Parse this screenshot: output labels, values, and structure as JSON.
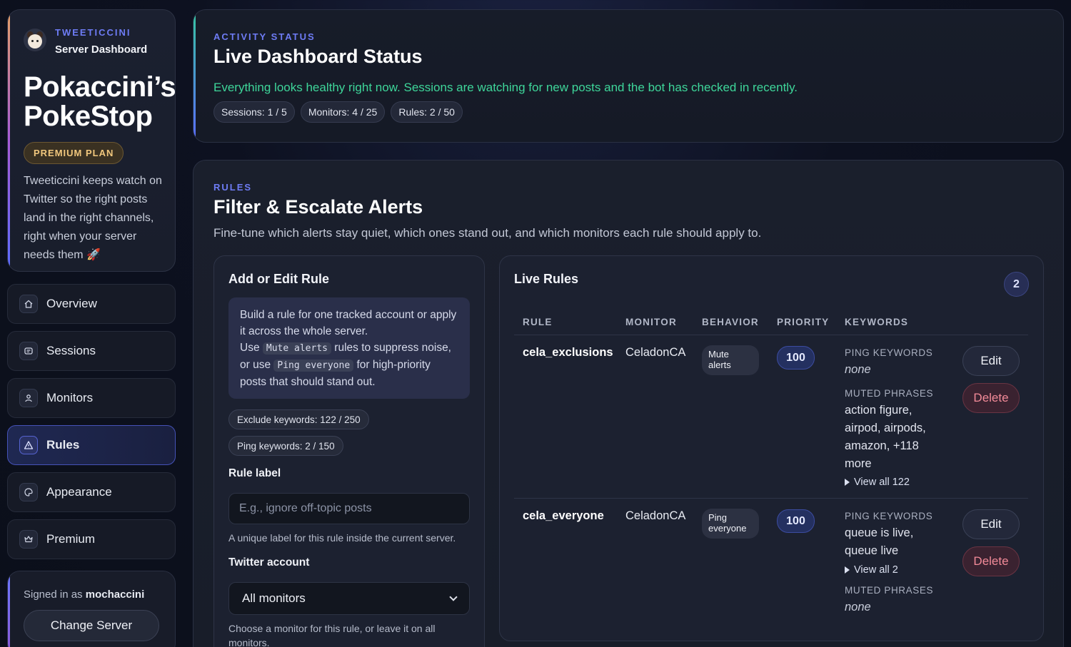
{
  "sidebar": {
    "app_name": "TWEETICCINI",
    "app_sub": "Server Dashboard",
    "server_name_line1": "Pokaccini’s",
    "server_name_line2": "PokeStop",
    "plan": "PREMIUM PLAN",
    "description": "Tweeticcini keeps watch on Twitter so the right posts land in the right channels, right when your server needs them 🚀",
    "nav": [
      {
        "label": "Overview",
        "icon": "home-icon"
      },
      {
        "label": "Sessions",
        "icon": "sessions-icon"
      },
      {
        "label": "Monitors",
        "icon": "user-icon"
      },
      {
        "label": "Rules",
        "icon": "warning-icon",
        "active": true
      },
      {
        "label": "Appearance",
        "icon": "palette-icon"
      },
      {
        "label": "Premium",
        "icon": "crown-icon"
      }
    ],
    "signed_in_prefix": "Signed in as",
    "signed_in_user": "mochaccini",
    "change_server": "Change Server"
  },
  "status": {
    "eyebrow": "ACTIVITY STATUS",
    "title": "Live Dashboard Status",
    "message": "Everything looks healthy right now. Sessions are watching for new posts and the bot has checked in recently.",
    "pills": [
      "Sessions: 1 / 5",
      "Monitors: 4 / 25",
      "Rules: 2 / 50"
    ],
    "accent_color": "#3ed69a"
  },
  "rules": {
    "eyebrow": "RULES",
    "title": "Filter & Escalate Alerts",
    "description": "Fine-tune which alerts stay quiet, which ones stand out, and which monitors each rule should apply to.",
    "form": {
      "title": "Add or Edit Rule",
      "info_line1": "Build a rule for one tracked account or apply it across the whole server.",
      "info_use": "Use",
      "info_mute_code": "Mute alerts",
      "info_mid": "rules to suppress noise, or use",
      "info_ping_code": "Ping everyone",
      "info_end": "for high-priority posts that should stand out.",
      "exclude_count": "Exclude keywords: 122 / 250",
      "ping_count": "Ping keywords: 2 / 150",
      "label_field": "Rule label",
      "label_placeholder": "E.g., ignore off-topic posts",
      "label_help": "A unique label for this rule inside the current server.",
      "account_field": "Twitter account",
      "account_value": "All monitors",
      "account_help": "Choose a monitor for this rule, or leave it on all monitors."
    },
    "live": {
      "title": "Live Rules",
      "count": "2",
      "headers": [
        "RULE",
        "MONITOR",
        "BEHAVIOR",
        "PRIORITY",
        "KEYWORDS"
      ],
      "ping_label": "PING KEYWORDS",
      "muted_label": "MUTED PHRASES",
      "edit": "Edit",
      "delete": "Delete",
      "rows": [
        {
          "name": "cela_exclusions",
          "monitor": "CeladonCA",
          "behavior_l1": "Mute",
          "behavior_l2": "alerts",
          "priority": "100",
          "ping_value": "none",
          "muted_value": "action figure, airpod, airpods, amazon, +118 more",
          "view_all": "View all 122"
        },
        {
          "name": "cela_everyone",
          "monitor": "CeladonCA",
          "behavior_l1": "Ping",
          "behavior_l2": "everyone",
          "priority": "100",
          "ping_value": "queue is live, queue live",
          "view_all": "View all 2",
          "muted_value": "none"
        }
      ]
    }
  }
}
